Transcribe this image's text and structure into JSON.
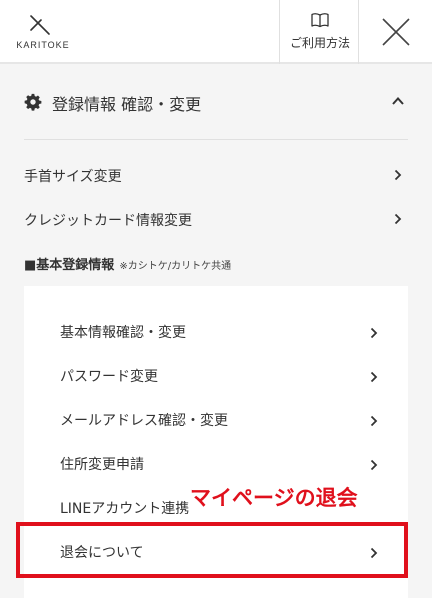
{
  "header": {
    "logo_text": "KARITOKE",
    "guide_label": "ご利用方法",
    "close_icon": "close-icon",
    "guide_icon": "book-icon"
  },
  "section": {
    "title": "登録情報 確認・変更",
    "icon": "gear-icon",
    "expanded": true
  },
  "items": [
    {
      "label": "手首サイズ変更"
    },
    {
      "label": "クレジットカード情報変更"
    }
  ],
  "basic": {
    "title": "■基本登録情報",
    "note": "※カシトケ/カリトケ共通",
    "items": [
      {
        "label": "基本情報確認・変更"
      },
      {
        "label": "パスワード変更"
      },
      {
        "label": "メールアドレス確認・変更"
      },
      {
        "label": "住所変更申請"
      },
      {
        "label": "LINEアカウント連携"
      },
      {
        "label": "退会について"
      }
    ]
  },
  "annotation": {
    "text": "マイページの退会",
    "color": "#e0101c"
  }
}
